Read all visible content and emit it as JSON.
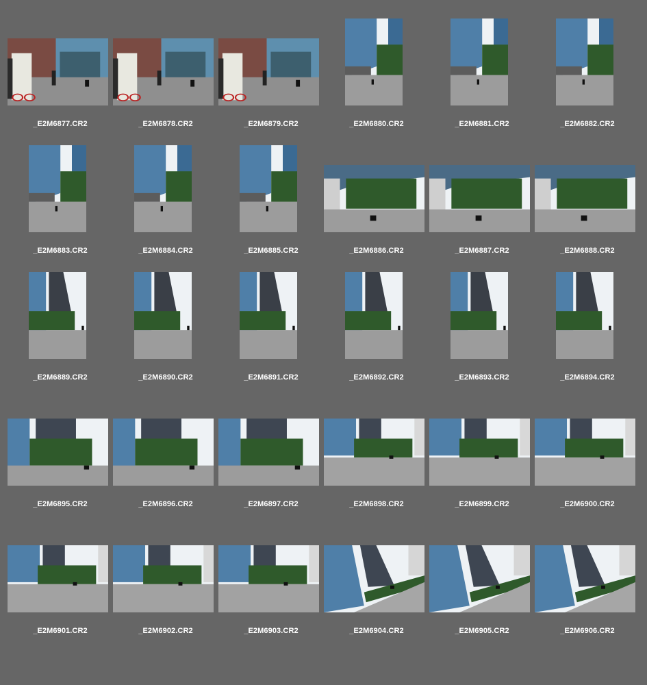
{
  "browser": {
    "files": [
      {
        "name": "_E2M6877.CR2",
        "orientation": "landscape",
        "scene": "street-van"
      },
      {
        "name": "_E2M6878.CR2",
        "orientation": "landscape",
        "scene": "street-van"
      },
      {
        "name": "_E2M6879.CR2",
        "orientation": "landscape",
        "scene": "street-van"
      },
      {
        "name": "_E2M6880.CR2",
        "orientation": "portrait",
        "scene": "tower-plaza"
      },
      {
        "name": "_E2M6881.CR2",
        "orientation": "portrait",
        "scene": "tower-plaza"
      },
      {
        "name": "_E2M6882.CR2",
        "orientation": "portrait",
        "scene": "tower-plaza"
      },
      {
        "name": "_E2M6883.CR2",
        "orientation": "portrait",
        "scene": "tower-plaza"
      },
      {
        "name": "_E2M6884.CR2",
        "orientation": "portrait",
        "scene": "tower-plaza"
      },
      {
        "name": "_E2M6885.CR2",
        "orientation": "portrait",
        "scene": "tower-plaza"
      },
      {
        "name": "_E2M6886.CR2",
        "orientation": "landscape",
        "scene": "trees-plaza"
      },
      {
        "name": "_E2M6887.CR2",
        "orientation": "landscape",
        "scene": "trees-plaza"
      },
      {
        "name": "_E2M6888.CR2",
        "orientation": "landscape",
        "scene": "trees-plaza"
      },
      {
        "name": "_E2M6889.CR2",
        "orientation": "portrait",
        "scene": "two-towers"
      },
      {
        "name": "_E2M6890.CR2",
        "orientation": "portrait",
        "scene": "two-towers"
      },
      {
        "name": "_E2M6891.CR2",
        "orientation": "portrait",
        "scene": "two-towers"
      },
      {
        "name": "_E2M6892.CR2",
        "orientation": "portrait",
        "scene": "two-towers"
      },
      {
        "name": "_E2M6893.CR2",
        "orientation": "portrait",
        "scene": "two-towers"
      },
      {
        "name": "_E2M6894.CR2",
        "orientation": "portrait",
        "scene": "two-towers"
      },
      {
        "name": "_E2M6895.CR2",
        "orientation": "landscape",
        "scene": "glass-trees"
      },
      {
        "name": "_E2M6896.CR2",
        "orientation": "landscape",
        "scene": "glass-trees"
      },
      {
        "name": "_E2M6897.CR2",
        "orientation": "landscape",
        "scene": "glass-trees"
      },
      {
        "name": "_E2M6898.CR2",
        "orientation": "landscape",
        "scene": "wide-plaza"
      },
      {
        "name": "_E2M6899.CR2",
        "orientation": "landscape",
        "scene": "wide-plaza"
      },
      {
        "name": "_E2M6900.CR2",
        "orientation": "landscape",
        "scene": "wide-plaza"
      },
      {
        "name": "_E2M6901.CR2",
        "orientation": "landscape",
        "scene": "wide-plaza"
      },
      {
        "name": "_E2M6902.CR2",
        "orientation": "landscape",
        "scene": "wide-plaza"
      },
      {
        "name": "_E2M6903.CR2",
        "orientation": "landscape",
        "scene": "wide-plaza"
      },
      {
        "name": "_E2M6904.CR2",
        "orientation": "landscape",
        "scene": "tilted-tower"
      },
      {
        "name": "_E2M6905.CR2",
        "orientation": "landscape",
        "scene": "tilted-tower"
      },
      {
        "name": "_E2M6906.CR2",
        "orientation": "landscape",
        "scene": "tilted-tower"
      }
    ]
  },
  "colors": {
    "background": "#666666",
    "caption": "#ffffff",
    "sky": "#eef2f5",
    "glass": "#4f7fa8",
    "pavement": "#9c9c9c",
    "trees": "#2f5a2b"
  }
}
